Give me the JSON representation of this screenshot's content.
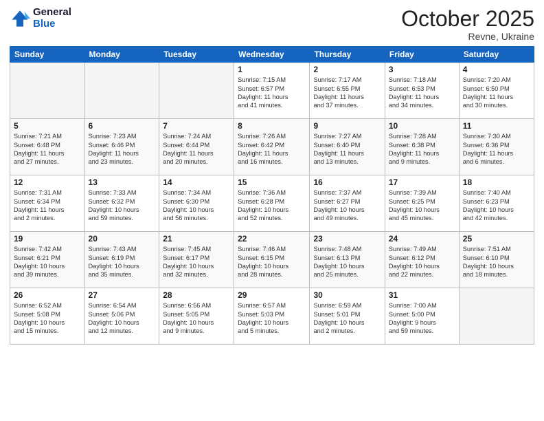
{
  "logo": {
    "line1": "General",
    "line2": "Blue"
  },
  "title": "October 2025",
  "location": "Revne, Ukraine",
  "days_header": [
    "Sunday",
    "Monday",
    "Tuesday",
    "Wednesday",
    "Thursday",
    "Friday",
    "Saturday"
  ],
  "weeks": [
    [
      {
        "num": "",
        "info": ""
      },
      {
        "num": "",
        "info": ""
      },
      {
        "num": "",
        "info": ""
      },
      {
        "num": "1",
        "info": "Sunrise: 7:15 AM\nSunset: 6:57 PM\nDaylight: 11 hours\nand 41 minutes."
      },
      {
        "num": "2",
        "info": "Sunrise: 7:17 AM\nSunset: 6:55 PM\nDaylight: 11 hours\nand 37 minutes."
      },
      {
        "num": "3",
        "info": "Sunrise: 7:18 AM\nSunset: 6:53 PM\nDaylight: 11 hours\nand 34 minutes."
      },
      {
        "num": "4",
        "info": "Sunrise: 7:20 AM\nSunset: 6:50 PM\nDaylight: 11 hours\nand 30 minutes."
      }
    ],
    [
      {
        "num": "5",
        "info": "Sunrise: 7:21 AM\nSunset: 6:48 PM\nDaylight: 11 hours\nand 27 minutes."
      },
      {
        "num": "6",
        "info": "Sunrise: 7:23 AM\nSunset: 6:46 PM\nDaylight: 11 hours\nand 23 minutes."
      },
      {
        "num": "7",
        "info": "Sunrise: 7:24 AM\nSunset: 6:44 PM\nDaylight: 11 hours\nand 20 minutes."
      },
      {
        "num": "8",
        "info": "Sunrise: 7:26 AM\nSunset: 6:42 PM\nDaylight: 11 hours\nand 16 minutes."
      },
      {
        "num": "9",
        "info": "Sunrise: 7:27 AM\nSunset: 6:40 PM\nDaylight: 11 hours\nand 13 minutes."
      },
      {
        "num": "10",
        "info": "Sunrise: 7:28 AM\nSunset: 6:38 PM\nDaylight: 11 hours\nand 9 minutes."
      },
      {
        "num": "11",
        "info": "Sunrise: 7:30 AM\nSunset: 6:36 PM\nDaylight: 11 hours\nand 6 minutes."
      }
    ],
    [
      {
        "num": "12",
        "info": "Sunrise: 7:31 AM\nSunset: 6:34 PM\nDaylight: 11 hours\nand 2 minutes."
      },
      {
        "num": "13",
        "info": "Sunrise: 7:33 AM\nSunset: 6:32 PM\nDaylight: 10 hours\nand 59 minutes."
      },
      {
        "num": "14",
        "info": "Sunrise: 7:34 AM\nSunset: 6:30 PM\nDaylight: 10 hours\nand 56 minutes."
      },
      {
        "num": "15",
        "info": "Sunrise: 7:36 AM\nSunset: 6:28 PM\nDaylight: 10 hours\nand 52 minutes."
      },
      {
        "num": "16",
        "info": "Sunrise: 7:37 AM\nSunset: 6:27 PM\nDaylight: 10 hours\nand 49 minutes."
      },
      {
        "num": "17",
        "info": "Sunrise: 7:39 AM\nSunset: 6:25 PM\nDaylight: 10 hours\nand 45 minutes."
      },
      {
        "num": "18",
        "info": "Sunrise: 7:40 AM\nSunset: 6:23 PM\nDaylight: 10 hours\nand 42 minutes."
      }
    ],
    [
      {
        "num": "19",
        "info": "Sunrise: 7:42 AM\nSunset: 6:21 PM\nDaylight: 10 hours\nand 39 minutes."
      },
      {
        "num": "20",
        "info": "Sunrise: 7:43 AM\nSunset: 6:19 PM\nDaylight: 10 hours\nand 35 minutes."
      },
      {
        "num": "21",
        "info": "Sunrise: 7:45 AM\nSunset: 6:17 PM\nDaylight: 10 hours\nand 32 minutes."
      },
      {
        "num": "22",
        "info": "Sunrise: 7:46 AM\nSunset: 6:15 PM\nDaylight: 10 hours\nand 28 minutes."
      },
      {
        "num": "23",
        "info": "Sunrise: 7:48 AM\nSunset: 6:13 PM\nDaylight: 10 hours\nand 25 minutes."
      },
      {
        "num": "24",
        "info": "Sunrise: 7:49 AM\nSunset: 6:12 PM\nDaylight: 10 hours\nand 22 minutes."
      },
      {
        "num": "25",
        "info": "Sunrise: 7:51 AM\nSunset: 6:10 PM\nDaylight: 10 hours\nand 18 minutes."
      }
    ],
    [
      {
        "num": "26",
        "info": "Sunrise: 6:52 AM\nSunset: 5:08 PM\nDaylight: 10 hours\nand 15 minutes."
      },
      {
        "num": "27",
        "info": "Sunrise: 6:54 AM\nSunset: 5:06 PM\nDaylight: 10 hours\nand 12 minutes."
      },
      {
        "num": "28",
        "info": "Sunrise: 6:56 AM\nSunset: 5:05 PM\nDaylight: 10 hours\nand 9 minutes."
      },
      {
        "num": "29",
        "info": "Sunrise: 6:57 AM\nSunset: 5:03 PM\nDaylight: 10 hours\nand 5 minutes."
      },
      {
        "num": "30",
        "info": "Sunrise: 6:59 AM\nSunset: 5:01 PM\nDaylight: 10 hours\nand 2 minutes."
      },
      {
        "num": "31",
        "info": "Sunrise: 7:00 AM\nSunset: 5:00 PM\nDaylight: 9 hours\nand 59 minutes."
      },
      {
        "num": "",
        "info": ""
      }
    ]
  ]
}
